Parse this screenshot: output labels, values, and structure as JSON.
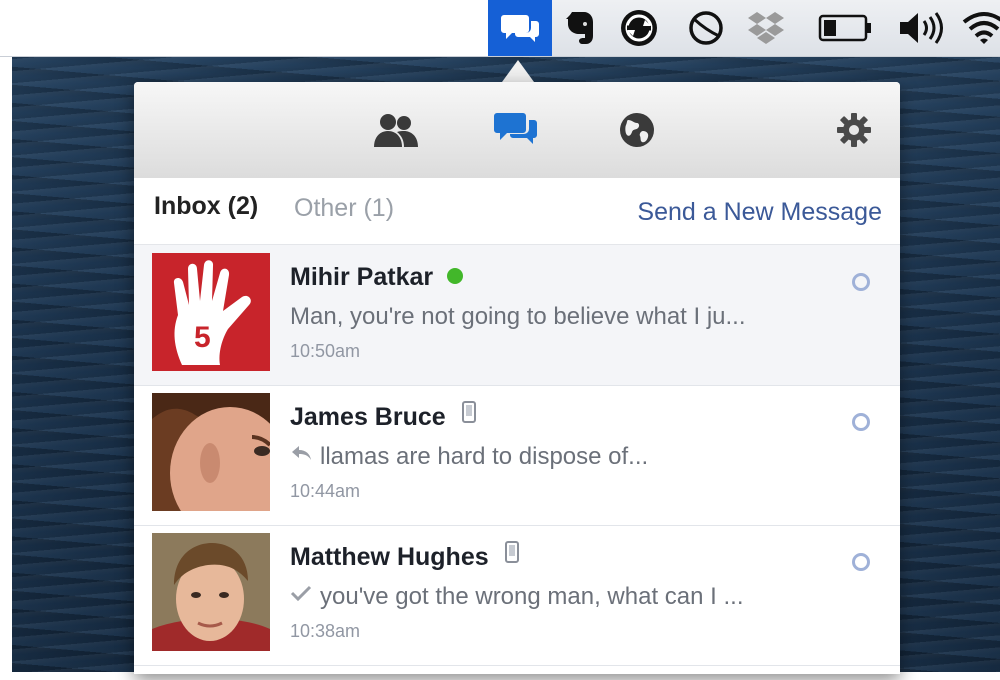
{
  "menubar": {
    "icons": [
      "messages-icon",
      "evernote-icon",
      "sync-icon",
      "disk-icon",
      "dropbox-icon",
      "battery-icon",
      "volume-icon",
      "wifi-icon"
    ]
  },
  "toolbar": {
    "buttons": [
      "friends-icon",
      "messages-icon",
      "globe-icon",
      "gear-icon"
    ],
    "active_color": "#1e73d2"
  },
  "tabs": {
    "inbox_label": "Inbox",
    "inbox_count": "(2)",
    "other_label": "Other",
    "other_count": "(1)",
    "send_new": "Send a New Message"
  },
  "conversations": [
    {
      "name": "Mihir Patkar",
      "status": "online",
      "snippet": "Man, you're not going to believe what I ju...",
      "time": "10:50am",
      "avatar_number": "5"
    },
    {
      "name": "James Bruce",
      "status": "mobile",
      "snippet": "llamas are hard to dispose of...",
      "snippet_icon": "reply-icon",
      "time": "10:44am"
    },
    {
      "name": "Matthew Hughes",
      "status": "mobile",
      "snippet": "you've got the wrong man, what can I ...",
      "snippet_icon": "seen-check-icon",
      "time": "10:38am"
    }
  ],
  "colors": {
    "link": "#3b5998",
    "online": "#42b72a",
    "menubar_active": "#1560d6"
  }
}
